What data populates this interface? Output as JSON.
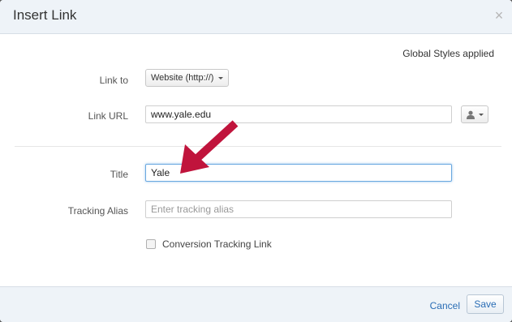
{
  "dialog": {
    "title": "Insert Link",
    "close_glyph": "×"
  },
  "global_styles_note": "Global Styles applied",
  "form": {
    "link_to": {
      "label": "Link to",
      "selected": "Website (http://)"
    },
    "link_url": {
      "label": "Link URL",
      "value": "www.yale.edu"
    },
    "title": {
      "label": "Title",
      "value": "Yale"
    },
    "tracking_alias": {
      "label": "Tracking Alias",
      "value": "",
      "placeholder": "Enter tracking alias"
    },
    "conversion_tracking": {
      "label": "Conversion Tracking Link",
      "checked": false
    }
  },
  "footer": {
    "cancel_label": "Cancel",
    "save_label": "Save"
  },
  "annotation": {
    "arrow_color": "#c0143c"
  },
  "colors": {
    "accent": "#2a6db5",
    "focus_border": "#6aa8e0",
    "header_bg": "#eef3f8"
  },
  "icons": {
    "close": "close-icon",
    "contact": "contact-person-icon",
    "dropdown": "chevron-down-icon"
  }
}
